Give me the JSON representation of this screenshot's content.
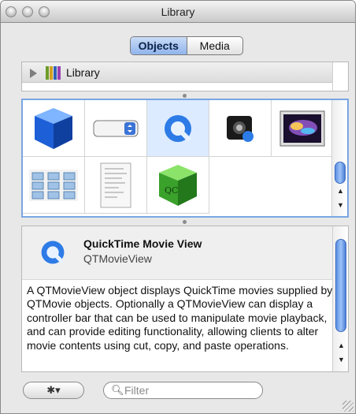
{
  "window": {
    "title": "Library"
  },
  "segmented": {
    "objects_label": "Objects",
    "media_label": "Media",
    "selected": "Objects"
  },
  "path": {
    "label": "Library"
  },
  "objects_grid": {
    "items": [
      {
        "icon": "blue-cube-icon"
      },
      {
        "icon": "popup-button-icon"
      },
      {
        "icon": "quicktime-view-icon",
        "selected": true
      },
      {
        "icon": "webcam-view-icon"
      },
      {
        "icon": "image-view-icon"
      },
      {
        "icon": "image-browser-icon"
      },
      {
        "icon": "pdf-view-icon"
      },
      {
        "icon": "quartz-composer-cube-icon"
      }
    ]
  },
  "detail": {
    "name": "QuickTime Movie View",
    "class": "QTMovieView",
    "description": "A QTMovieView object displays QuickTime movies supplied by QTMovie objects. Optionally a QTMovieView can display a controller bar that can be used to manipulate movie playback, and can provide editing functionality, allowing clients to alter movie contents using cut, copy, and paste operations."
  },
  "bottom": {
    "gear_label": "✱▾",
    "filter_placeholder": "Filter"
  },
  "colors": {
    "selection": "#dcebff",
    "accent": "#79a6e4",
    "scroll_thumb": "#5a8fe3"
  }
}
